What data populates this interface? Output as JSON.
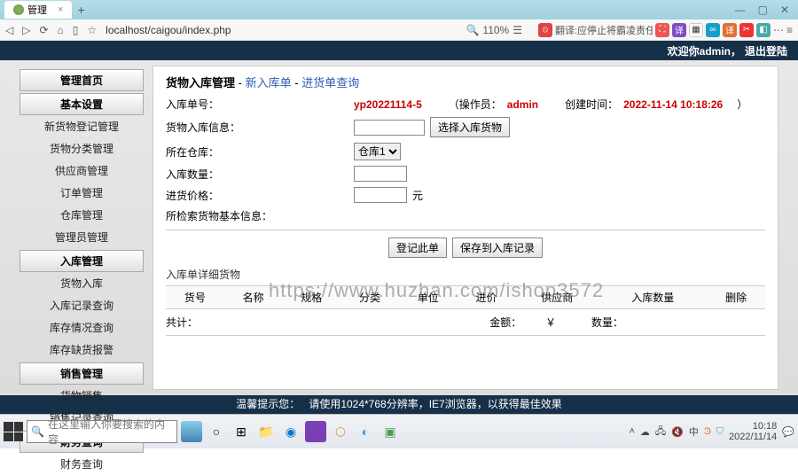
{
  "browser": {
    "tab_title": "管理",
    "url": "localhost/caigou/index.php",
    "zoom": "110%",
    "translate_hint": "翻译:应停止将霸凌责任甩锅"
  },
  "header": {
    "welcome": "欢迎你admin，",
    "logout": "退出登陆"
  },
  "sidebar": {
    "groups": [
      {
        "header": "管理首页",
        "items": []
      },
      {
        "header": "基本设置",
        "items": [
          "新货物登记管理",
          "货物分类管理",
          "供应商管理",
          "订单管理",
          "仓库管理",
          "管理员管理"
        ]
      },
      {
        "header": "入库管理",
        "items": [
          "货物入库",
          "入库记录查询",
          "库存情况查询",
          "库存缺货报警"
        ]
      },
      {
        "header": "销售管理",
        "items": [
          "货物销售",
          "销售记录查询"
        ]
      },
      {
        "header": "财务查询",
        "items": [
          "财务查询"
        ]
      }
    ]
  },
  "crumb": {
    "title": "货物入库管理",
    "sep": " - ",
    "link1": "新入库单",
    "link2": "进货单查询"
  },
  "form": {
    "order_label": "入库单号：",
    "order_value": "yp20221114-5",
    "operator_label": "（操作员：",
    "operator_value": "admin",
    "created_label": "创建时间：",
    "created_value": "2022-11-14 10:18:26",
    "close_paren": "）",
    "info_label": "货物入库信息：",
    "select_goods_btn": "选择入库货物",
    "warehouse_label": "所在仓库：",
    "warehouse_opt": "仓库1",
    "qty_label": "入库数量：",
    "price_label": "进货价格：",
    "price_unit": "元",
    "search_info_label": "所检索货物基本信息：",
    "reg_btn": "登记此单",
    "save_btn": "保存到入库记录"
  },
  "detail": {
    "section": "入库单详细货物",
    "cols": [
      "货号",
      "名称",
      "规格",
      "分类",
      "单位",
      "进价",
      "供应商",
      "入库数量",
      "删除"
    ],
    "total_label": "共计：",
    "amount_label": "金额：",
    "currency": "￥",
    "qty_label": "数量："
  },
  "watermark": "https://www.huzhan.com/ishop3572",
  "tip": {
    "label": "温馨提示您：",
    "text": "请使用1024*768分辨率，IE7浏览器，以获得最佳效果"
  },
  "taskbar": {
    "search_placeholder": "在这里输入你要搜索的内容",
    "time": "10:18",
    "date": "2022/11/14"
  }
}
